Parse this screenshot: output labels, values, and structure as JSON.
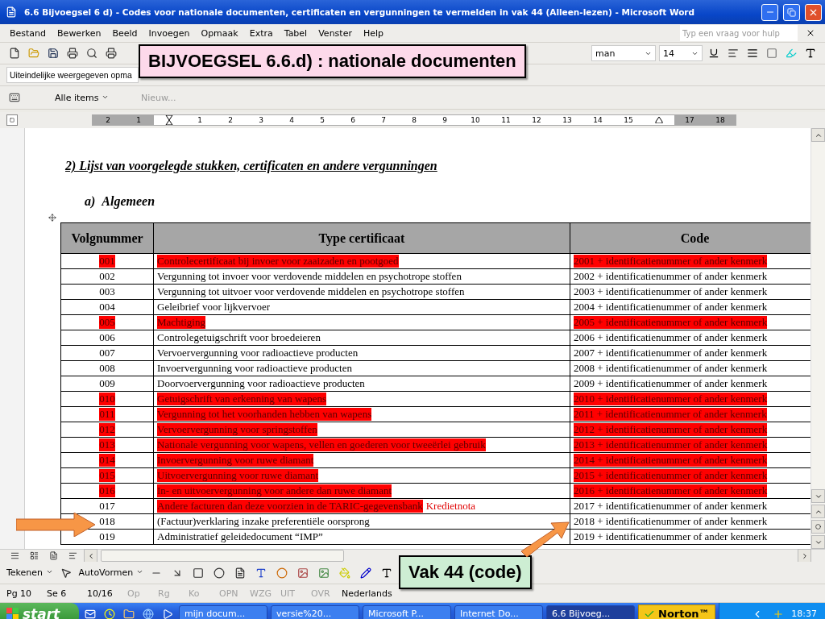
{
  "window": {
    "title": "6.6 Bijvoegsel 6 d) - Codes voor nationale documenten, certificaten en vergunningen te vermelden in vak 44 (Alleen-lezen) - Microsoft Word"
  },
  "menu": [
    "Bestand",
    "Bewerken",
    "Beeld",
    "Invoegen",
    "Opmaak",
    "Extra",
    "Tabel",
    "Venster",
    "Help"
  ],
  "help_box": {
    "placeholder": "Typ een vraag voor hulp"
  },
  "formatting": {
    "font": "man",
    "size": "14"
  },
  "review_toolbar": {
    "display_mode": "Uiteindelijke weergegeven opma"
  },
  "outlook_toolbar": {
    "items": "Alle items",
    "new": {
      "label": "Nieuw...",
      "disabled": true
    }
  },
  "ruler": {
    "left_ticks": [
      "2",
      "1"
    ],
    "ticks": [
      "1",
      "2",
      "3",
      "4",
      "5",
      "6",
      "7",
      "8",
      "9",
      "10",
      "11",
      "12",
      "13",
      "14",
      "15"
    ],
    "right_ticks": [
      "17",
      "18"
    ]
  },
  "document": {
    "heading": "2) Lijst van voorgelegde stukken, certificaten en andere vergunningen",
    "subheading": "a)  Algemeen",
    "table": {
      "columns": [
        "Volgnummer",
        "Type certificaat",
        "Code"
      ],
      "rows": [
        {
          "number": "001",
          "type": "Controlecertificaat bij invoer voor zaaizaden en pootgoed",
          "code": "2001 + identificatienummer of ander kenmerk",
          "highlighted": true
        },
        {
          "number": "002",
          "type": "Vergunning tot invoer voor verdovende middelen en psychotrope stoffen",
          "code": "2002 + identificatienummer of ander kenmerk",
          "highlighted": false
        },
        {
          "number": "003",
          "type": "Vergunning tot uitvoer voor verdovende middelen en psychotrope stoffen",
          "code": "2003 + identificatienummer of ander kenmerk",
          "highlighted": false
        },
        {
          "number": "004",
          "type": "Geleibrief voor lijkvervoer",
          "code": "2004 + identificatienummer of ander kenmerk",
          "highlighted": false
        },
        {
          "number": "005",
          "type": "Machtiging",
          "code": "2005 + identificatienummer of ander kenmerk",
          "highlighted": true
        },
        {
          "number": "006",
          "type": "Controlegetuigschrift voor broedeieren",
          "code": "2006 + identificatienummer of ander kenmerk",
          "highlighted": false
        },
        {
          "number": "007",
          "type": "Vervoervergunning voor radioactieve producten",
          "code": "2007 + identificatienummer of ander kenmerk",
          "highlighted": false
        },
        {
          "number": "008",
          "type": "Invoervergunning voor radioactieve producten",
          "code": "2008 + identificatienummer of ander kenmerk",
          "highlighted": false
        },
        {
          "number": "009",
          "type": "Doorvoervergunning voor radioactieve producten",
          "code": "2009 + identificatienummer of ander kenmerk",
          "highlighted": false
        },
        {
          "number": "010",
          "type": "Getuigschrift van erkenning van wapens",
          "code": "2010 + identificatienummer of ander kenmerk",
          "highlighted": true
        },
        {
          "number": "011",
          "type": "Vergunning tot het voorhanden hebben van wapens",
          "code": "2011 + identificatienummer of ander kenmerk",
          "highlighted": true
        },
        {
          "number": "012",
          "type": "Vervoervergunning voor springstoffen",
          "code": "2012 + identificatienummer of ander kenmerk",
          "highlighted": true
        },
        {
          "number": "013",
          "type": "Nationale vergunning voor wapens, vellen en goederen voor tweeërlei gebruik",
          "code": "2013 + identificatienummer of ander kenmerk",
          "highlighted": true
        },
        {
          "number": "014",
          "type": "Invoervergunning voor ruwe diamant",
          "code": "2014 + identificatienummer of ander kenmerk",
          "highlighted": true
        },
        {
          "number": "015",
          "type": "Uitvoervergunning voor ruwe diamant",
          "code": "2015 + identificatienummer of ander kenmerk",
          "highlighted": true
        },
        {
          "number": "016",
          "type": "In- en uitvoervergunning voor andere dan ruwe diamant",
          "code": "2016 + identificatienummer of ander kenmerk",
          "highlighted": true
        },
        {
          "number": "017",
          "type": "Andere facturen dan deze voorzien in de TARIC-gegevensbank",
          "note": "Kredietnota",
          "code": "2017 + identificatienummer of ander kenmerk",
          "highlighted": false,
          "type_highlighted": true
        },
        {
          "number": "018",
          "type": "(Factuur)verklaring inzake preferentiële oorsprong",
          "code": "2018 + identificatienummer of ander kenmerk",
          "highlighted": false
        },
        {
          "number": "019",
          "type": "Administratief geleidedocument “IMP”",
          "code": "2019 + identificatienummer of ander kenmerk",
          "highlighted": false
        }
      ]
    }
  },
  "drawing_toolbar": {
    "draw": "Tekenen",
    "autoshapes": "AutoVormen"
  },
  "status_bar": {
    "fields": [
      {
        "text": "Pg 10",
        "disabled": false
      },
      {
        "text": "Se 6",
        "disabled": false
      },
      {
        "text": "10/16",
        "disabled": false
      },
      {
        "text": "Op",
        "disabled": true
      },
      {
        "text": "Rg",
        "disabled": true
      },
      {
        "text": "Ko",
        "disabled": true
      },
      {
        "text": "OPN",
        "disabled": true
      },
      {
        "text": "WZG",
        "disabled": true
      },
      {
        "text": "UIT",
        "disabled": true
      },
      {
        "text": "OVR",
        "disabled": true
      }
    ],
    "language": "Nederlands"
  },
  "taskbar": {
    "start": "start",
    "tasks": [
      {
        "label": "mijn docum...",
        "selected": false
      },
      {
        "label": "versie%20...",
        "selected": false
      },
      {
        "label": "Microsoft P...",
        "selected": false
      },
      {
        "label": "Internet Do...",
        "selected": false
      },
      {
        "label": "6.6 Bijvoeg...",
        "selected": true
      }
    ],
    "norton": "Norton™",
    "clock": "18:37"
  },
  "callouts": [
    {
      "text": "BIJVOEGSEL 6.6.d) : nationale documenten",
      "color": "#fdd9ea"
    },
    {
      "text": "Vak 44 (code)",
      "color": "#cdeed3"
    }
  ]
}
